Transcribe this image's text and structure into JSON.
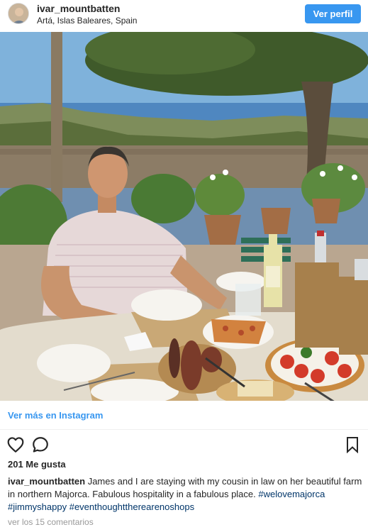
{
  "header": {
    "username": "ivar_mountbatten",
    "location": "Artá, Islas Baleares, Spain",
    "follow_label": "Ver perfil"
  },
  "post": {
    "view_more_label": "Ver más en Instagram",
    "likes_label": "201 Me gusta",
    "caption_user": "ivar_mountbatten",
    "caption_text": "James and I are staying with my cousin in law on her beautiful farm in northern Majorca. Fabulous hospitality in a fabulous place.",
    "hashtags": [
      "#welovemajorca",
      "#jimmyshappy",
      "#eventhoughttherearenoshops"
    ],
    "comments_label": "ver los 15 comentarios"
  },
  "icons": {
    "like": "heart-icon",
    "comment": "comment-bubble-icon",
    "save": "bookmark-icon"
  },
  "colors": {
    "accent": "#3897f0",
    "hashtag": "#003569",
    "muted": "#999999"
  }
}
